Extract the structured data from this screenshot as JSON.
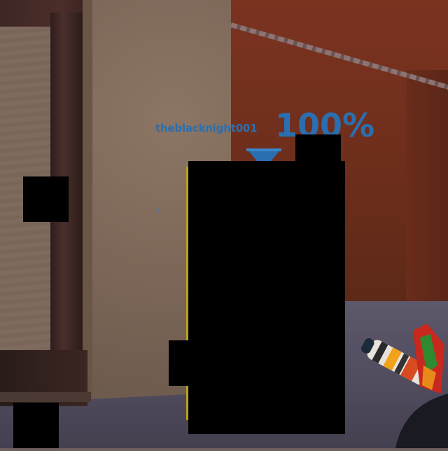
{
  "hud": {
    "player_name": "theblacknight001",
    "health_percent_text": "100%",
    "team_color": "#2a6fb0"
  },
  "icons": {
    "marker": "team-marker-triangle-icon",
    "weapon": "held-weapon-icon"
  }
}
